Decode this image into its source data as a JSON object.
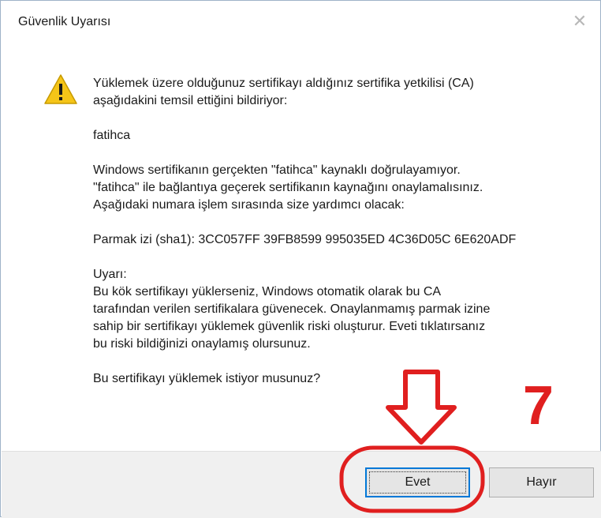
{
  "window": {
    "title": "Güvenlik Uyarısı",
    "close_label": "✕"
  },
  "icons": {
    "warning": "warning-icon"
  },
  "message": {
    "line1a": "Yüklemek üzere olduğunuz sertifikayı aldığınız sertifika yetkilisi (CA)",
    "line1b": "aşağıdakini temsil ettiğini bildiriyor:",
    "issuer": "fatihca",
    "para2a": "Windows sertifikanın gerçekten \"fatihca\" kaynaklı doğrulayamıyor.",
    "para2b": "\"fatihca\" ile bağlantıya geçerek sertifikanın kaynağını onaylamalısınız.",
    "para2c": "Aşağıdaki numara işlem sırasında size yardımcı olacak:",
    "thumbprint": "Parmak izi (sha1): 3CC057FF 39FB8599 995035ED 4C36D05C 6E620ADF",
    "warning_title": "Uyarı:",
    "warn1": "Bu kök sertifikayı yüklerseniz, Windows otomatik olarak bu CA",
    "warn2": "tarafından verilen sertifikalara güvenecek. Onaylanmamış parmak izine",
    "warn3": "sahip bir sertifikayı yüklemek güvenlik riski oluşturur. Eveti tıklatırsanız",
    "warn4": "bu riski bildiğinizi onaylamış olursunuz.",
    "question": "Bu sertifikayı yüklemek istiyor musunuz?"
  },
  "buttons": {
    "yes": "Evet",
    "no": "Hayır"
  },
  "annotation": {
    "step_number": "7",
    "color": "#e01f1f"
  }
}
